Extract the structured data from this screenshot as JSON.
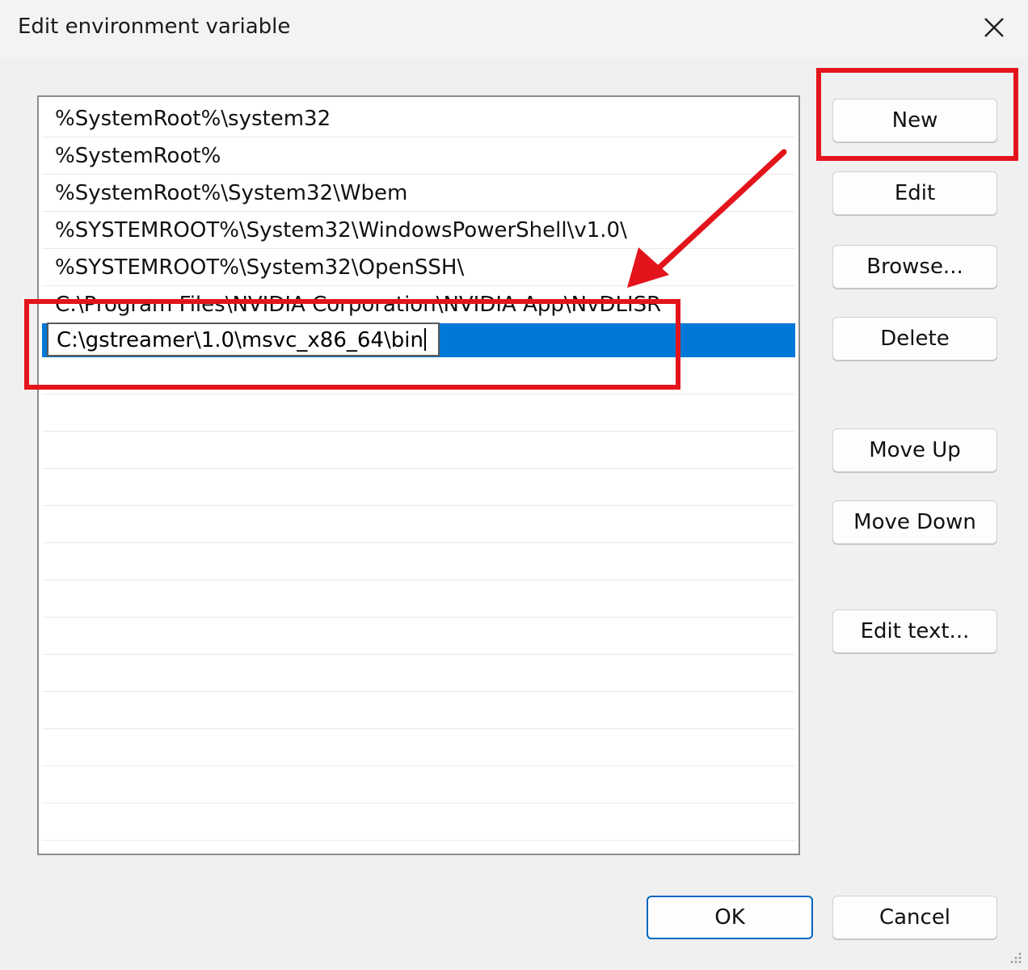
{
  "window": {
    "title": "Edit environment variable"
  },
  "entries": [
    {
      "label": "%SystemRoot%\\system32"
    },
    {
      "label": "%SystemRoot%"
    },
    {
      "label": "%SystemRoot%\\System32\\Wbem"
    },
    {
      "label": "%SYSTEMROOT%\\System32\\WindowsPowerShell\\v1.0\\"
    },
    {
      "label": "%SYSTEMROOT%\\System32\\OpenSSH\\"
    },
    {
      "label": "C:\\Program Files\\NVIDIA Corporation\\NVIDIA App\\NvDLISR"
    }
  ],
  "editing": {
    "value": "C:\\gstreamer\\1.0\\msvc_x86_64\\bin"
  },
  "buttons": {
    "new": "New",
    "edit": "Edit",
    "browse": "Browse...",
    "delete": "Delete",
    "move_up": "Move Up",
    "move_down": "Move Down",
    "edit_text": "Edit text...",
    "ok": "OK",
    "cancel": "Cancel"
  },
  "colors": {
    "selection": "#0078d7",
    "annotation": "#e3141b",
    "ok_border": "#0067c0"
  },
  "icons": {
    "close": "close-icon",
    "resize": "resize-grip-icon"
  }
}
